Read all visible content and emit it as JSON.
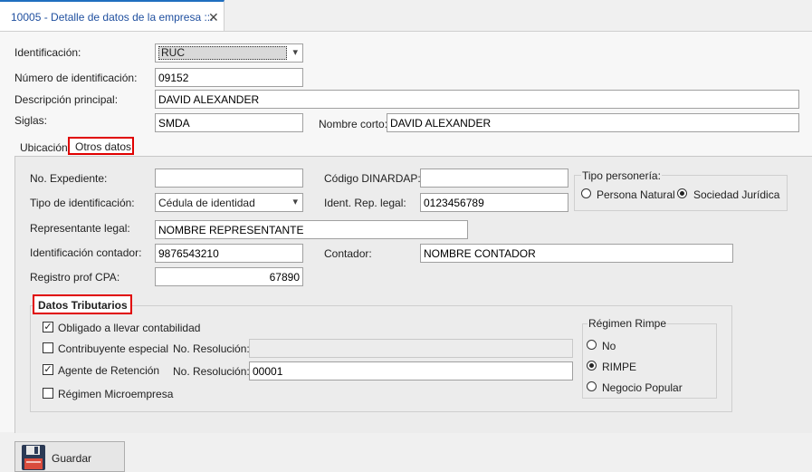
{
  "tab": {
    "title": "10005 - Detalle de datos de la empresa ::.",
    "close": "✕"
  },
  "identificacion": {
    "label": "Identificación:",
    "value": "RUC"
  },
  "numero": {
    "label": "Número de identificación:",
    "value": "09152"
  },
  "descripcion": {
    "label": "Descripción principal:",
    "value": "DAVID ALEXANDER"
  },
  "siglas": {
    "label": "Siglas:",
    "value": "SMDA"
  },
  "nombre_corto": {
    "label": "Nombre corto:",
    "value": "DAVID ALEXANDER"
  },
  "subtabs": {
    "ubicacion": "Ubicación",
    "otros": "Otros datos"
  },
  "otros": {
    "expediente": {
      "label": "No. Expediente:",
      "value": ""
    },
    "dinardap": {
      "label": "Código DINARDAP:",
      "value": ""
    },
    "tipo_ident": {
      "label": "Tipo de identificación:",
      "value": "Cédula de identidad"
    },
    "ident_rep": {
      "label": "Ident. Rep. legal:",
      "value": "0123456789"
    },
    "representante": {
      "label": "Representante legal:",
      "value": "NOMBRE REPRESENTANTE"
    },
    "ident_contador": {
      "label": "Identificación contador:",
      "value": "9876543210"
    },
    "contador": {
      "label": "Contador:",
      "value": "NOMBRE CONTADOR"
    },
    "registro_cpa": {
      "label": "Registro prof CPA:",
      "value": "67890"
    },
    "personeria": {
      "title": "Tipo personería:",
      "natural": "Persona Natural",
      "juridica": "Sociedad Jurídica"
    }
  },
  "tributarios": {
    "title": "Datos Tributarios",
    "obligado": "Obligado a llevar contabilidad",
    "especial": "Contribuyente especial",
    "especial_res_label": "No. Resolución:",
    "especial_res_value": "",
    "retencion": "Agente de Retención",
    "retencion_res_label": "No. Resolución:",
    "retencion_res_value": "00001",
    "microempresa": "Régimen Microempresa"
  },
  "rimpe": {
    "title": "Régimen Rimpe",
    "no": "No",
    "rimpe": "RIMPE",
    "negocio": "Negocio Popular"
  },
  "save": {
    "label": "Guardar"
  },
  "icons": {
    "chevron": "▾",
    "check": "✓"
  }
}
